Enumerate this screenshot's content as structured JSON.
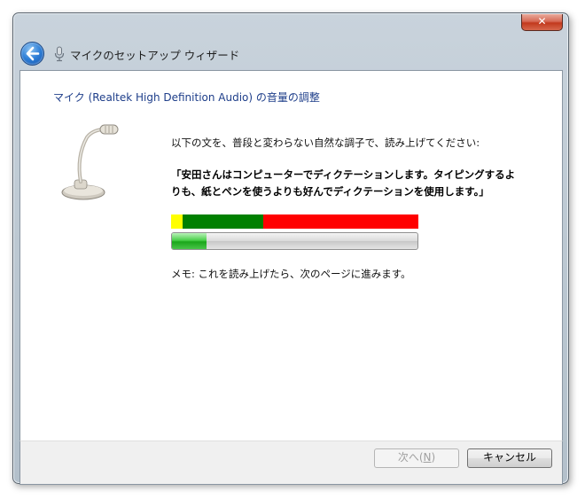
{
  "window": {
    "title": "マイクのセットアップ ウィザード",
    "close_label": "✕"
  },
  "heading": "マイク (Realtek High Definition Audio) の音量の調整",
  "instruction": "以下の文を、普段と変わらない自然な調子で、読み上げてください:",
  "phrase_line1": "「安田さんはコンピューターでディクテーションします。タイピングするよ",
  "phrase_line2": "りも、紙とペンを使うよりも好んでディクテーションを使用します。」",
  "level_meter": {
    "segments": [
      "yellow",
      "green",
      "red"
    ],
    "colors": {
      "yellow": "#ffff00",
      "green": "#008000",
      "red": "#ff0000"
    }
  },
  "progress": {
    "value_fraction": 0.14
  },
  "memo": "メモ: これを読み上げたら、次のページに進みます。",
  "buttons": {
    "next_label": "次へ(",
    "next_mnemonic": "N",
    "next_suffix": ")",
    "next_enabled": false,
    "cancel_label": "キャンセル"
  },
  "icons": [
    "back-arrow-icon",
    "microphone-icon",
    "close-icon"
  ]
}
